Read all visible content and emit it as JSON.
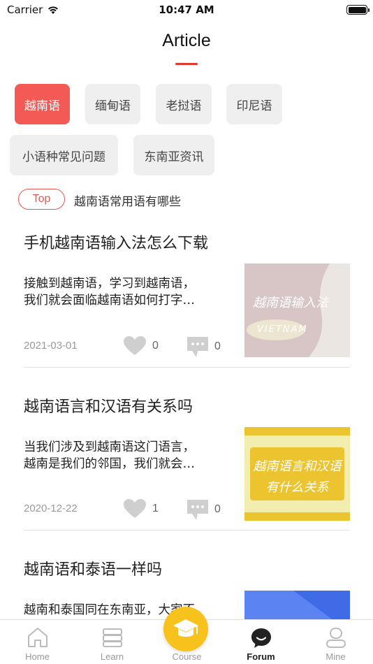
{
  "status_bar": {
    "carrier": "Carrier",
    "time": "10:47 AM"
  },
  "header": {
    "title": "Article"
  },
  "categories": [
    {
      "label": "越南语",
      "active": true
    },
    {
      "label": "缅甸语",
      "active": false
    },
    {
      "label": "老挝语",
      "active": false
    },
    {
      "label": "印尼语",
      "active": false
    },
    {
      "label": "小语种常见问题",
      "active": false
    },
    {
      "label": "东南亚资讯",
      "active": false
    }
  ],
  "top_item": {
    "badge": "Top",
    "text": "越南语常用语有哪些"
  },
  "articles": [
    {
      "title": "手机越南语输入法怎么下载",
      "summary_line1": "接触到越南语，学习到越南语，",
      "summary_line2": "我们就会面临越南语如何打字…",
      "date": "2021-03-01",
      "likes": "0",
      "comments": "0",
      "thumb_line1": "越南语输入法",
      "thumb_line2": "VIETNAM"
    },
    {
      "title": "越南语言和汉语有关系吗",
      "summary_line1": "当我们涉及到越南语这门语言，",
      "summary_line2": "越南是我们的邻国，我们就会…",
      "date": "2020-12-22",
      "likes": "1",
      "comments": "0",
      "thumb_line1": "越南语言和汉语",
      "thumb_line2": "有什么关系"
    },
    {
      "title": "越南语和泰语一样吗",
      "summary_line1": "越南和泰国同在东南亚，大家不"
    }
  ],
  "tabbar": {
    "tabs": [
      {
        "label": "Home"
      },
      {
        "label": "Learn"
      },
      {
        "label": "Course"
      },
      {
        "label": "Forum"
      },
      {
        "label": "Mine"
      }
    ]
  },
  "colors": {
    "accent": "#f35a55",
    "course": "#f7c21c",
    "underline": "#e23a2e"
  }
}
